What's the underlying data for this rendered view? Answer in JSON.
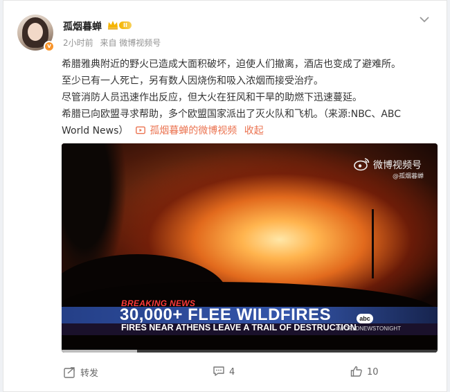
{
  "user": {
    "name": "孤烟暮蝉",
    "level_badge": "II",
    "verified_badge": "v",
    "time": "2小时前",
    "source": "来自 微博视频号"
  },
  "post": {
    "line1": "希腊雅典附近的野火已造成大面积破坏，迫使人们撤离，酒店也变成了避难所。",
    "line2": "至少已有一人死亡，另有数人因烧伤和吸入浓烟而接受治疗。",
    "line3": "尽管消防人员迅速作出反应，但大火在狂风和干旱的助燃下迅速蔓延。",
    "line4": "希腊已向欧盟寻求帮助，多个欧盟国家派出了灭火队和飞机。（来源:NBC、ABC",
    "line5_prefix": "World News）",
    "video_link": "孤烟暮蝉的微博视频",
    "collapse": "收起"
  },
  "video": {
    "watermark": "微博视频号",
    "watermark_user": "@孤烟暮蝉",
    "breaking": "BREAKING NEWS",
    "headline": "30,000+ FLEE WILDFIRES",
    "subline": "FIRES NEAR ATHENS LEAVE A TRAIL OF DESTRUCTION",
    "network": "abc",
    "hashtag": "#WORLDNEWSTONIGHT",
    "progress": 0.2
  },
  "actions": {
    "repost": "转发",
    "comments": "4",
    "likes": "10"
  },
  "colors": {
    "link": "#eb7350",
    "breaking": "#ff3b3b"
  }
}
